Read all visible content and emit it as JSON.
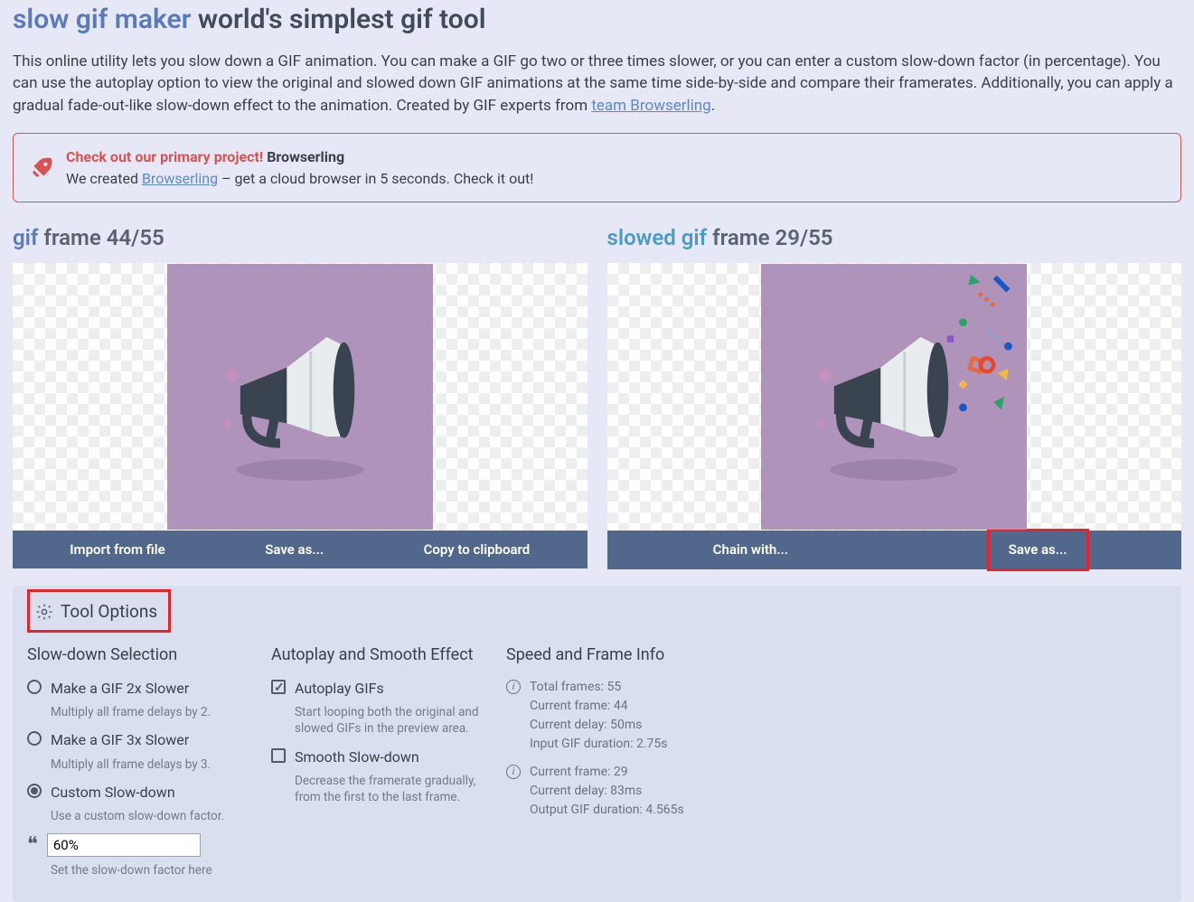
{
  "header": {
    "title_highlight": "slow gif maker",
    "title_rest": " world's simplest gif tool"
  },
  "intro": {
    "text": "This online utility lets you slow down a GIF animation. You can make a GIF go two or three times slower, or you can enter a custom slow-down factor (in percentage). You can use the autoplay option to view the original and slowed down GIF animations at the same time side-by-side and compare their framerates. Additionally, you can apply a gradual fade-out-like slow-down effect to the animation. Created by GIF experts from ",
    "link_text": "team Browserling",
    "after": "."
  },
  "promo": {
    "lead": "Check out our primary project!",
    "name": " Browserling",
    "line2_a": "We created ",
    "line2_link": "Browserling",
    "line2_b": " – get a cloud browser in 5 seconds. Check it out!"
  },
  "left_panel": {
    "prefix": "gif",
    "counter": " frame 44/55",
    "btn_import": "Import from file",
    "btn_save": "Save as...",
    "btn_copy": "Copy to clipboard"
  },
  "right_panel": {
    "prefix": "slowed gif",
    "counter": " frame 29/55",
    "btn_chain": "Chain with...",
    "btn_save": "Save as..."
  },
  "options": {
    "title": "Tool Options",
    "col1": {
      "heading": "Slow-down Selection",
      "opt1": "Make a GIF 2x Slower",
      "opt1_desc": "Multiply all frame delays by 2.",
      "opt2": "Make a GIF 3x Slower",
      "opt2_desc": "Multiply all frame delays by 3.",
      "opt3": "Custom Slow-down",
      "opt3_desc": "Use a custom slow-down factor.",
      "input_value": "60%",
      "input_desc": "Set the slow-down factor here"
    },
    "col2": {
      "heading": "Autoplay and Smooth Effect",
      "opt1": "Autoplay GIFs",
      "opt1_desc": "Start looping both the original and slowed GIFs in the preview area.",
      "opt2": "Smooth Slow-down",
      "opt2_desc": "Decrease the framerate gradually, from the first to the last frame."
    },
    "col3": {
      "heading": "Speed and Frame Info",
      "block1_l1": "Total frames: 55",
      "block1_l2": "Current frame: 44",
      "block1_l3": "Current delay: 50ms",
      "block1_l4": "Input GIF duration: 2.75s",
      "block2_l1": "Current frame: 29",
      "block2_l2": "Current delay: 83ms",
      "block2_l3": "Output GIF duration: 4.565s"
    }
  }
}
